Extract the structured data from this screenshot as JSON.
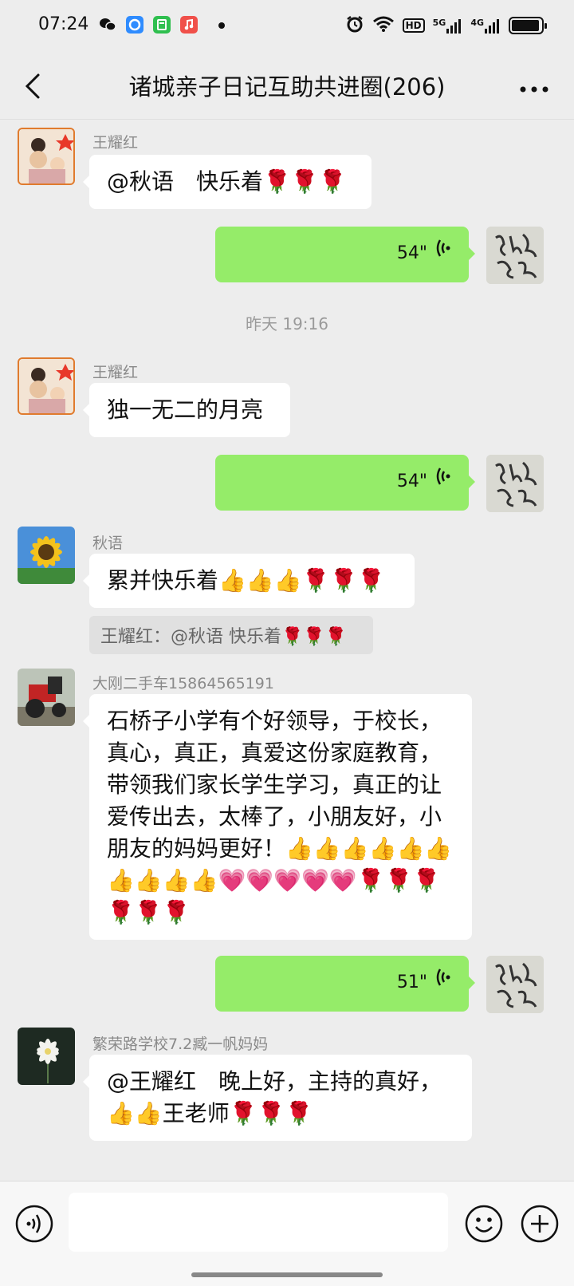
{
  "status_bar": {
    "time": "07:24",
    "apps": [
      "wechat-icon",
      "browser-icon",
      "calculator-icon",
      "music-icon"
    ],
    "indicators": [
      "alarm-icon",
      "wifi-icon",
      "HD",
      "5G",
      "4G"
    ],
    "battery_level": 0.95
  },
  "header": {
    "title": "诸城亲子日记互助共进圈(206)",
    "back_icon": "chevron-left-icon",
    "more_icon": "more-horizontal-icon"
  },
  "messages": [
    {
      "side": "left",
      "sender": "王耀红",
      "text": "@秋语　快乐着🌹🌹🌹"
    },
    {
      "side": "right",
      "duration": "54\""
    },
    {
      "timestamp": "昨天 19:16"
    },
    {
      "side": "left",
      "sender": "王耀红",
      "text": "独一无二的月亮"
    },
    {
      "side": "right",
      "duration": "54\""
    },
    {
      "side": "left",
      "sender": "秋语",
      "text": "累并快乐着👍👍👍🌹🌹🌹",
      "quote": "王耀红：@秋语 快乐着🌹🌹🌹"
    },
    {
      "side": "left",
      "sender": "大刚二手车15864565191",
      "text": "石桥子小学有个好领导，于校长，真心，真正，真爱这份家庭教育，带领我们家长学生学习，真正的让爱传出去，太棒了，小朋友好，小朋友的妈妈更好！👍👍👍👍👍👍👍👍👍👍💗💗💗💗💗🌹🌹🌹🌹🌹🌹"
    },
    {
      "side": "right",
      "duration": "51\""
    },
    {
      "side": "left",
      "sender": "繁荣路学校7.2臧一帆妈妈",
      "text": "@王耀红　晚上好，主持的真好，👍👍王老师🌹🌹🌹"
    }
  ],
  "input": {
    "placeholder": "",
    "voice_icon": "voice-icon",
    "emoji_icon": "emoji-icon",
    "plus_icon": "plus-icon"
  },
  "colors": {
    "background": "#ededed",
    "sent_bubble": "#95ec69",
    "received_bubble": "#ffffff"
  }
}
